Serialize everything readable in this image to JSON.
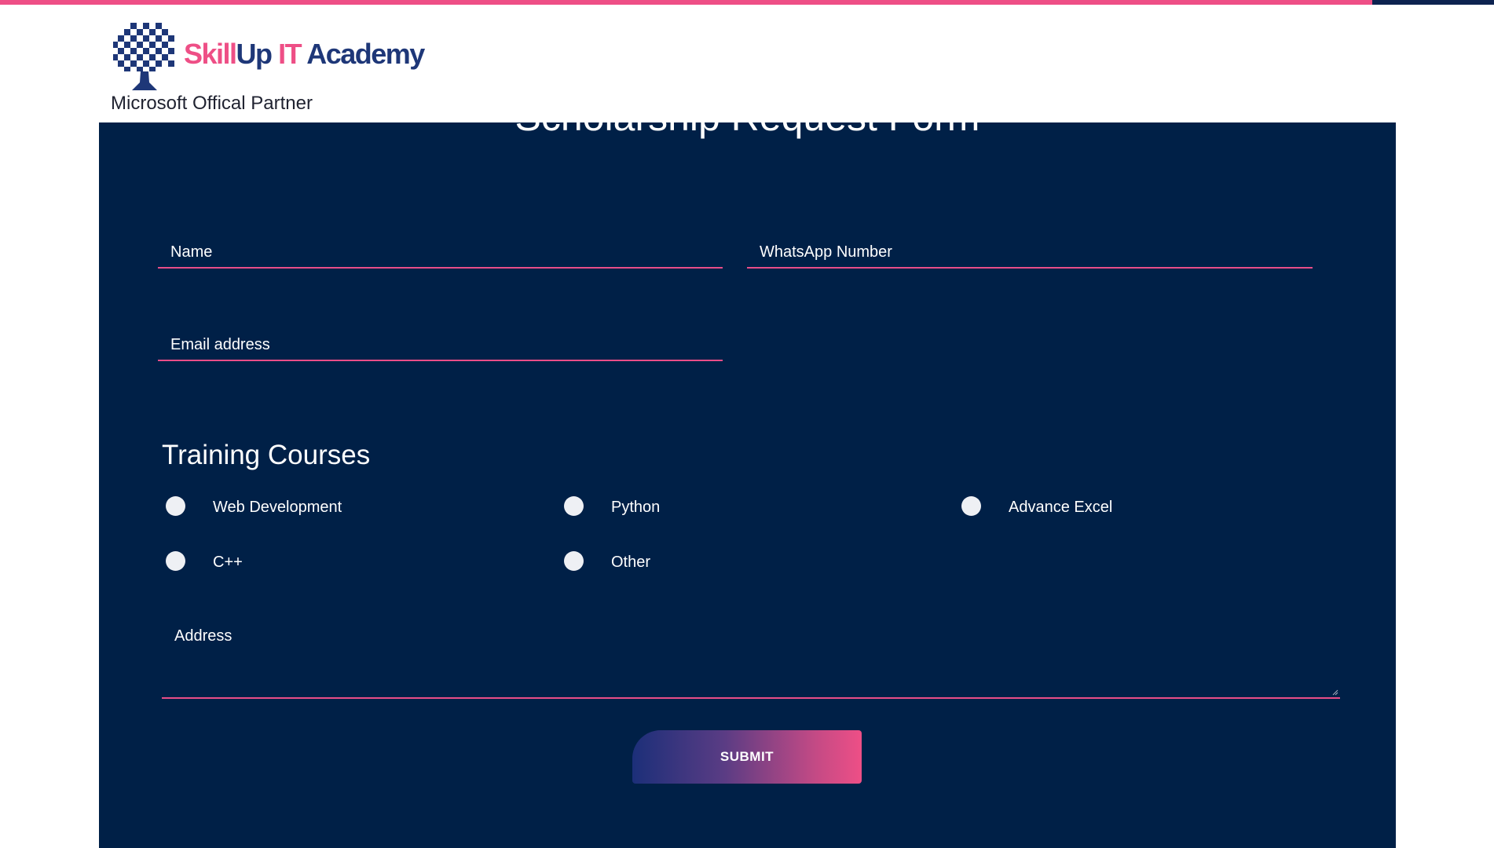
{
  "header": {
    "logo_text_part1": "Skill",
    "logo_text_part2": "Up",
    "logo_text_part3": "IT",
    "logo_text_part4": "Academy",
    "subtitle": "Microsoft Offical Partner",
    "logo_icon": "chess-board-tree-icon"
  },
  "form": {
    "title": "Scholarship Request Form",
    "name_placeholder": "Name",
    "whatsapp_placeholder": "WhatsApp Number",
    "email_placeholder": "Email address",
    "courses_heading": "Training Courses",
    "courses": [
      {
        "label": "Web Development",
        "selected": false
      },
      {
        "label": "Python",
        "selected": false
      },
      {
        "label": "Advance Excel",
        "selected": false
      },
      {
        "label": "C++",
        "selected": false
      },
      {
        "label": "Other",
        "selected": false
      }
    ],
    "address_placeholder": "Address",
    "submit_label": "SUBMIT"
  },
  "colors": {
    "accent_pink": "#ee4f86",
    "navy_panel": "#002047",
    "logo_navy": "#1e3778"
  }
}
